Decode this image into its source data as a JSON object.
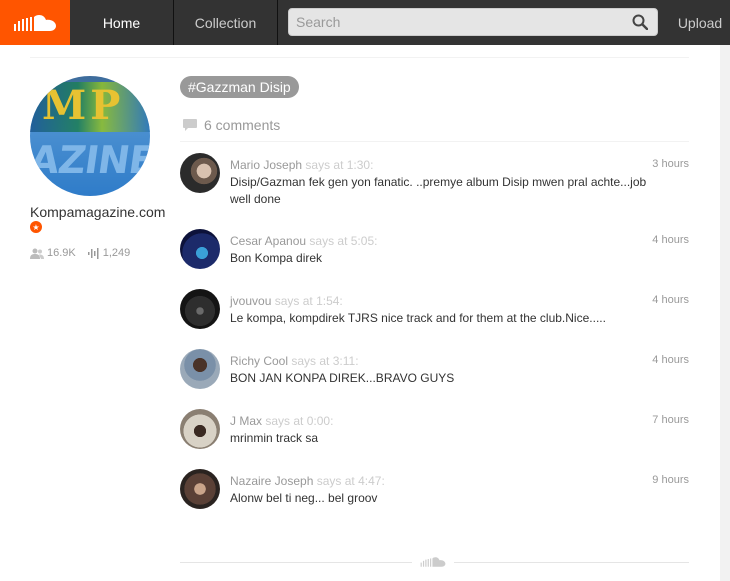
{
  "header": {
    "logo": "soundcloud-logo",
    "nav": [
      {
        "label": "Home"
      },
      {
        "label": "Collection"
      }
    ],
    "search": {
      "placeholder": "Search",
      "value": ""
    },
    "upload": "Upload",
    "colors": {
      "brand": "#ff5500",
      "bar": "#333333"
    }
  },
  "profile": {
    "name": "Kompamagazine.com",
    "followers": "16.9K",
    "tracks": "1,249"
  },
  "tag": "Gazzman Disip",
  "comments_header": "6 comments",
  "comments": [
    {
      "user": "Mario Joseph",
      "says": "says at 1:30:",
      "time": "3 hours",
      "text": "Disip/Gazman fek gen yon fanatic. ..premye album Disip mwen pral achte...job well done"
    },
    {
      "user": "Cesar Apanou",
      "says": "says at 5:05:",
      "time": "4 hours",
      "text": "Bon Kompa direk"
    },
    {
      "user": "jvouvou",
      "says": "says at 1:54:",
      "time": "4 hours",
      "text": "Le kompa, kompdirek TJRS nice track and for them at the club.Nice....."
    },
    {
      "user": "Richy Cool",
      "says": "says at 3:11:",
      "time": "4 hours",
      "text": "BON JAN KONPA DIREK...BRAVO GUYS"
    },
    {
      "user": "J Max",
      "says": "says at 0:00:",
      "time": "7 hours",
      "text": "mrinmin track sa"
    },
    {
      "user": "Nazaire Joseph",
      "says": "says at 4:47:",
      "time": "9 hours",
      "text": "Alonw bel ti neg... bel groov"
    }
  ]
}
